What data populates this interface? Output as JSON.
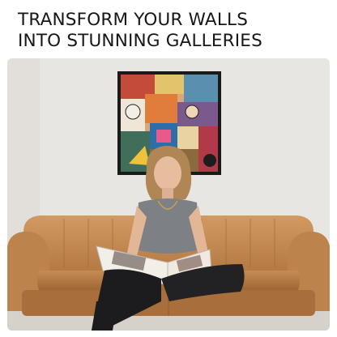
{
  "headline": {
    "line1": "TRANSFORM YOUR WALLS",
    "line2": "INTO STUNNING GALLERIES"
  },
  "colors": {
    "text": "#161616",
    "wall": "#e8e6e2",
    "sofa": "#c48a52",
    "frame": "#1a1a1a"
  }
}
